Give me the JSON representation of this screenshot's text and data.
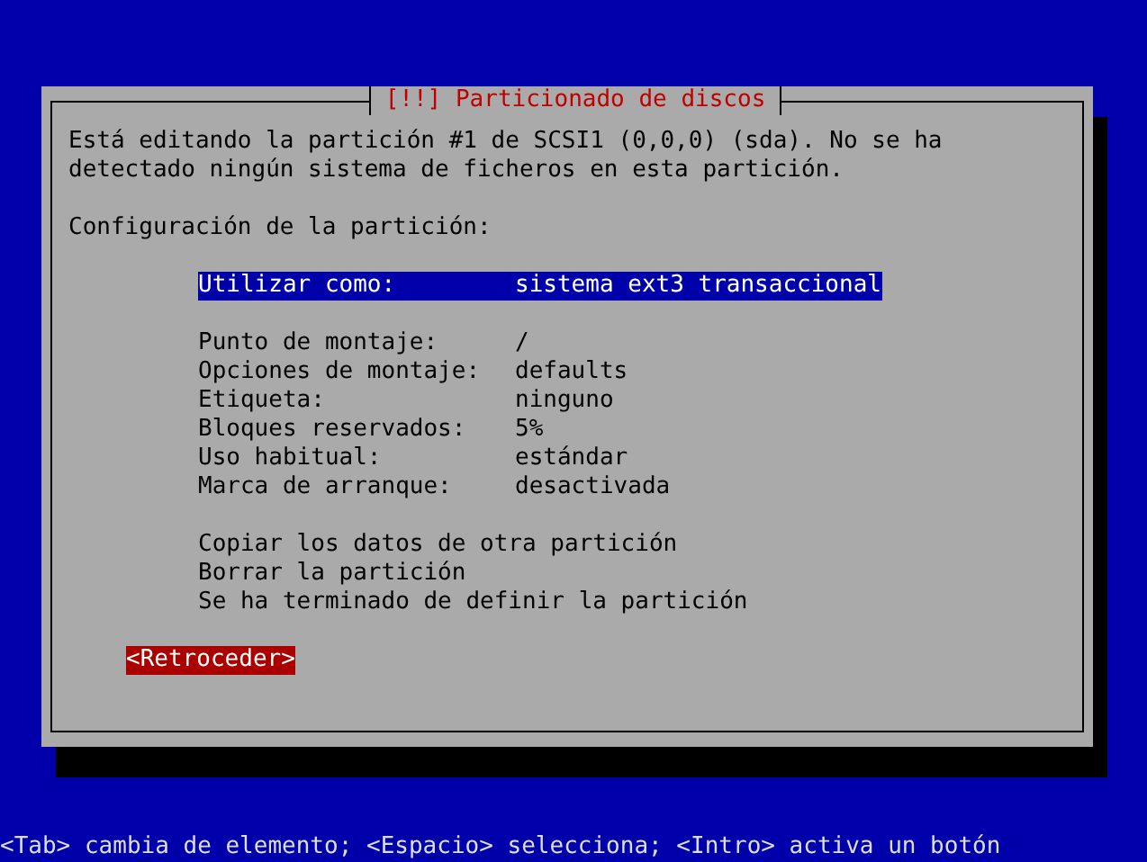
{
  "dialog": {
    "title": "[!!] Particionado de discos",
    "message": [
      "Está editando la partición #1 de SCSI1 (0,0,0) (sda). No se ha",
      "detectado ningún sistema de ficheros en esta partición."
    ],
    "section_label": "Configuración de la partición:",
    "menu_groups": [
      [
        {
          "kind": "setting",
          "label": "Utilizar como:",
          "value": "sistema ext3 transaccional",
          "selected": true
        }
      ],
      [
        {
          "kind": "setting",
          "label": "Punto de montaje:",
          "value": "/",
          "selected": false
        },
        {
          "kind": "setting",
          "label": "Opciones de montaje:",
          "value": "defaults",
          "selected": false
        },
        {
          "kind": "setting",
          "label": "Etiqueta:",
          "value": "ninguno",
          "selected": false
        },
        {
          "kind": "setting",
          "label": "Bloques reservados:",
          "value": "5%",
          "selected": false
        },
        {
          "kind": "setting",
          "label": "Uso habitual:",
          "value": "estándar",
          "selected": false
        },
        {
          "kind": "setting",
          "label": "Marca de arranque:",
          "value": "desactivada",
          "selected": false
        }
      ],
      [
        {
          "kind": "action",
          "label": "Copiar los datos de otra partición",
          "selected": false
        },
        {
          "kind": "action",
          "label": "Borrar la partición",
          "selected": false
        },
        {
          "kind": "action",
          "label": "Se ha terminado de definir la partición",
          "selected": false
        }
      ]
    ],
    "buttons": [
      {
        "label": "<Retroceder>",
        "selected": true
      }
    ]
  },
  "status_bar": "<Tab> cambia de elemento; <Espacio> selecciona; <Intro> activa un botón"
}
